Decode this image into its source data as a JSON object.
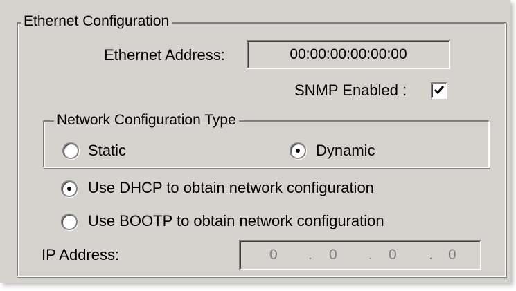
{
  "ethernet": {
    "group_title": "Ethernet Configuration",
    "address_label": "Ethernet Address:",
    "address_value": "00:00:00:00:00:00",
    "snmp_label": "SNMP Enabled :",
    "snmp_checked": true
  },
  "network_type": {
    "group_title": "Network Configuration Type",
    "static_label": "Static",
    "dynamic_label": "Dynamic",
    "selected": "Dynamic"
  },
  "dynamic_options": {
    "dhcp_label": "Use DHCP to obtain network configuration",
    "bootp_label": "Use BOOTP to obtain network configuration",
    "selected": "DHCP"
  },
  "ip": {
    "label": "IP Address:",
    "octets": [
      "0",
      "0",
      "0",
      "0"
    ],
    "separator": "."
  },
  "colors": {
    "dialog_bg": "#d6d3ce",
    "disabled_text": "#808080"
  }
}
